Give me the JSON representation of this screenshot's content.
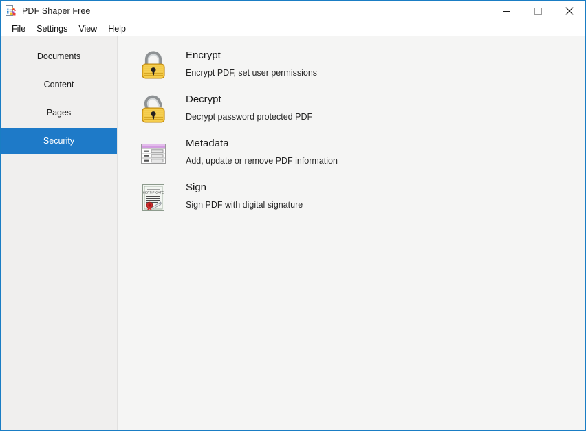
{
  "window": {
    "title": "PDF Shaper Free",
    "app_icon": "pdf-shaper-app-icon",
    "controls": {
      "minimize": "minimize-icon",
      "maximize": "maximize-icon",
      "close": "close-icon"
    }
  },
  "menubar": {
    "items": [
      {
        "label": "File"
      },
      {
        "label": "Settings"
      },
      {
        "label": "View"
      },
      {
        "label": "Help"
      }
    ]
  },
  "sidebar": {
    "items": [
      {
        "label": "Documents",
        "selected": false
      },
      {
        "label": "Content",
        "selected": false
      },
      {
        "label": "Pages",
        "selected": false
      },
      {
        "label": "Security",
        "selected": true
      }
    ]
  },
  "main": {
    "actions": [
      {
        "title": "Encrypt",
        "description": "Encrypt PDF, set user permissions",
        "icon": "closed-padlock-icon"
      },
      {
        "title": "Decrypt",
        "description": "Decrypt password protected PDF",
        "icon": "open-padlock-icon"
      },
      {
        "title": "Metadata",
        "description": "Add, update or remove PDF information",
        "icon": "metadata-table-icon"
      },
      {
        "title": "Sign",
        "description": "Sign PDF with digital signature",
        "icon": "certificate-signature-icon"
      }
    ]
  },
  "colors": {
    "accent": "#1e7ac8",
    "window_border": "#1a7dc4",
    "sidebar_bg": "#f0efee",
    "content_bg": "#f5f5f4",
    "lock_body": "#f2c13c",
    "lock_shackle": "#b9bcbd",
    "metadata_header": "#c88fd6",
    "seal_red": "#c1272d"
  }
}
